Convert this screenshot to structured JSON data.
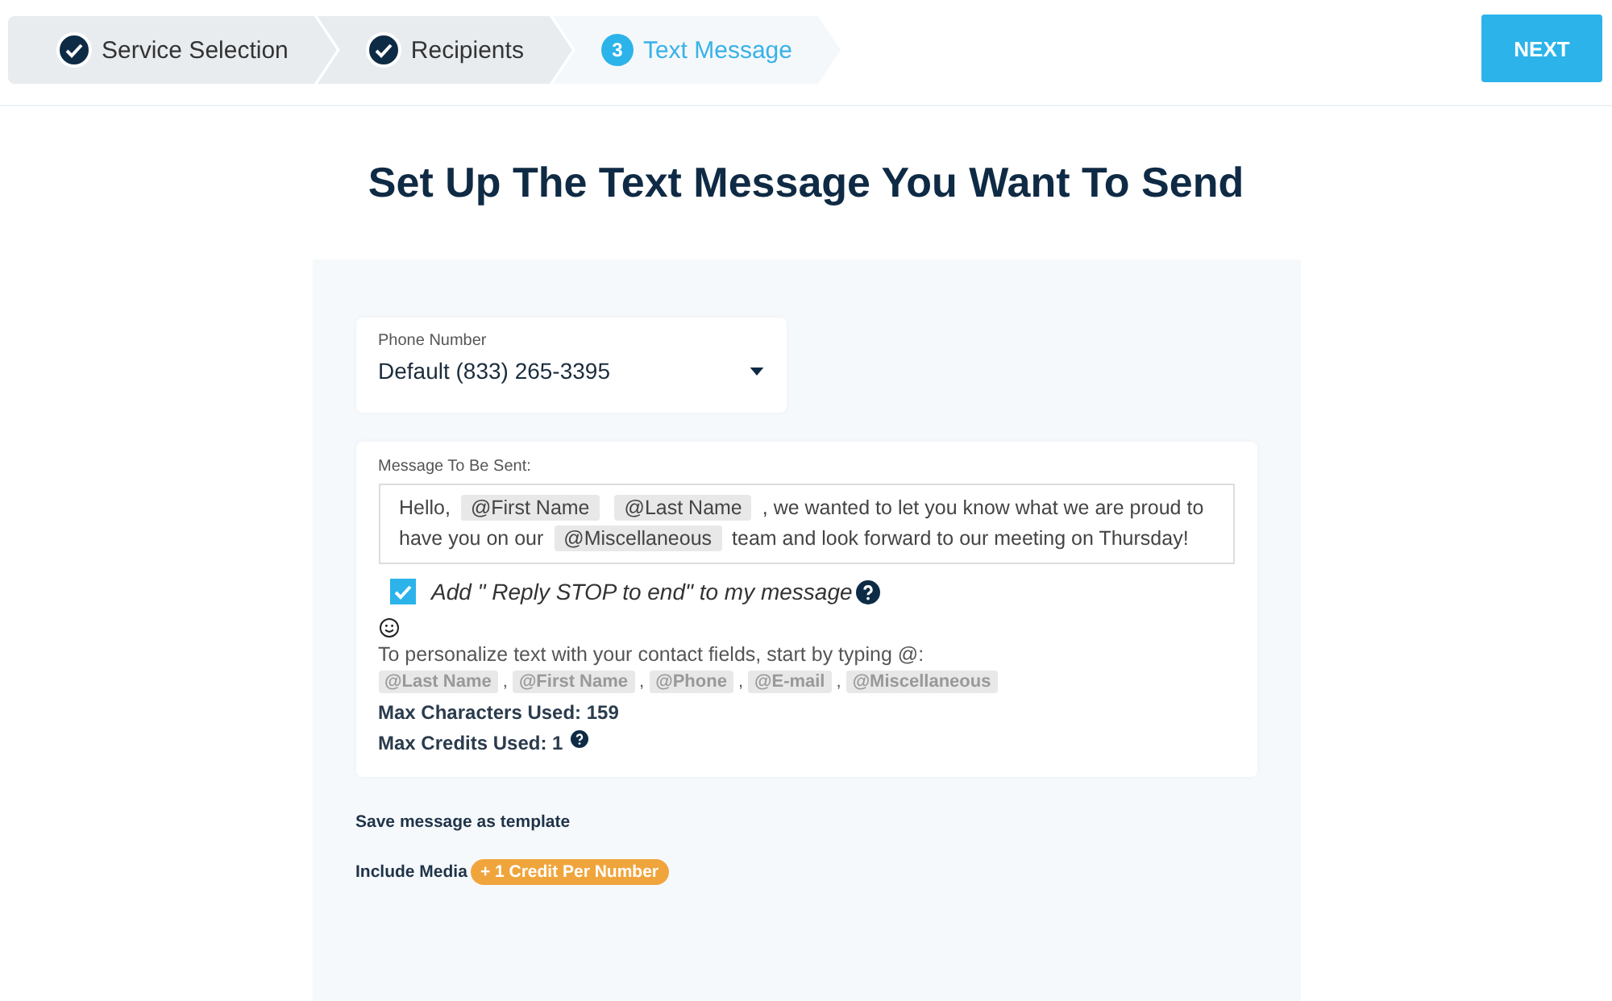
{
  "steps": [
    {
      "kind": "done",
      "label": "Service Selection"
    },
    {
      "kind": "done",
      "label": "Recipients"
    },
    {
      "kind": "current",
      "number": "3",
      "label": "Text Message"
    }
  ],
  "next_button": "NEXT",
  "heading": "Set Up The Text Message You Want To Send",
  "phone": {
    "label": "Phone Number",
    "value": "Default (833) 265-3395"
  },
  "message": {
    "label": "Message To Be Sent:",
    "segments": [
      {
        "kind": "text",
        "text": "Hello,"
      },
      {
        "kind": "token",
        "text": "@First Name"
      },
      {
        "kind": "token",
        "text": "@Last Name"
      },
      {
        "kind": "text",
        "text": ", we wanted to let you know what we are proud to"
      },
      {
        "kind": "text",
        "text": "have you on our"
      },
      {
        "kind": "token",
        "text": "@Miscellaneous"
      },
      {
        "kind": "text",
        "text": "team and look forward to our meeting on Thursday!"
      }
    ]
  },
  "reply_stop": {
    "label": "Add \" Reply STOP to end\" to my message",
    "checked": true
  },
  "personalize_hint": "To personalize text with your contact fields, start by typing @:",
  "contact_fields": [
    {
      "text": "@Last Name",
      "separator": ","
    },
    {
      "text": "@First Name",
      "separator": ","
    },
    {
      "text": "@Phone",
      "separator": ","
    },
    {
      "text": "@E-mail",
      "separator": ","
    },
    {
      "text": "@Miscellaneous"
    }
  ],
  "max_characters": "Max Characters Used: 159",
  "max_credits": "Max Credits Used: 1",
  "save_template": "Save message as template",
  "include_media": {
    "label": "Include Media",
    "badge": "+ 1 Credit Per Number"
  }
}
